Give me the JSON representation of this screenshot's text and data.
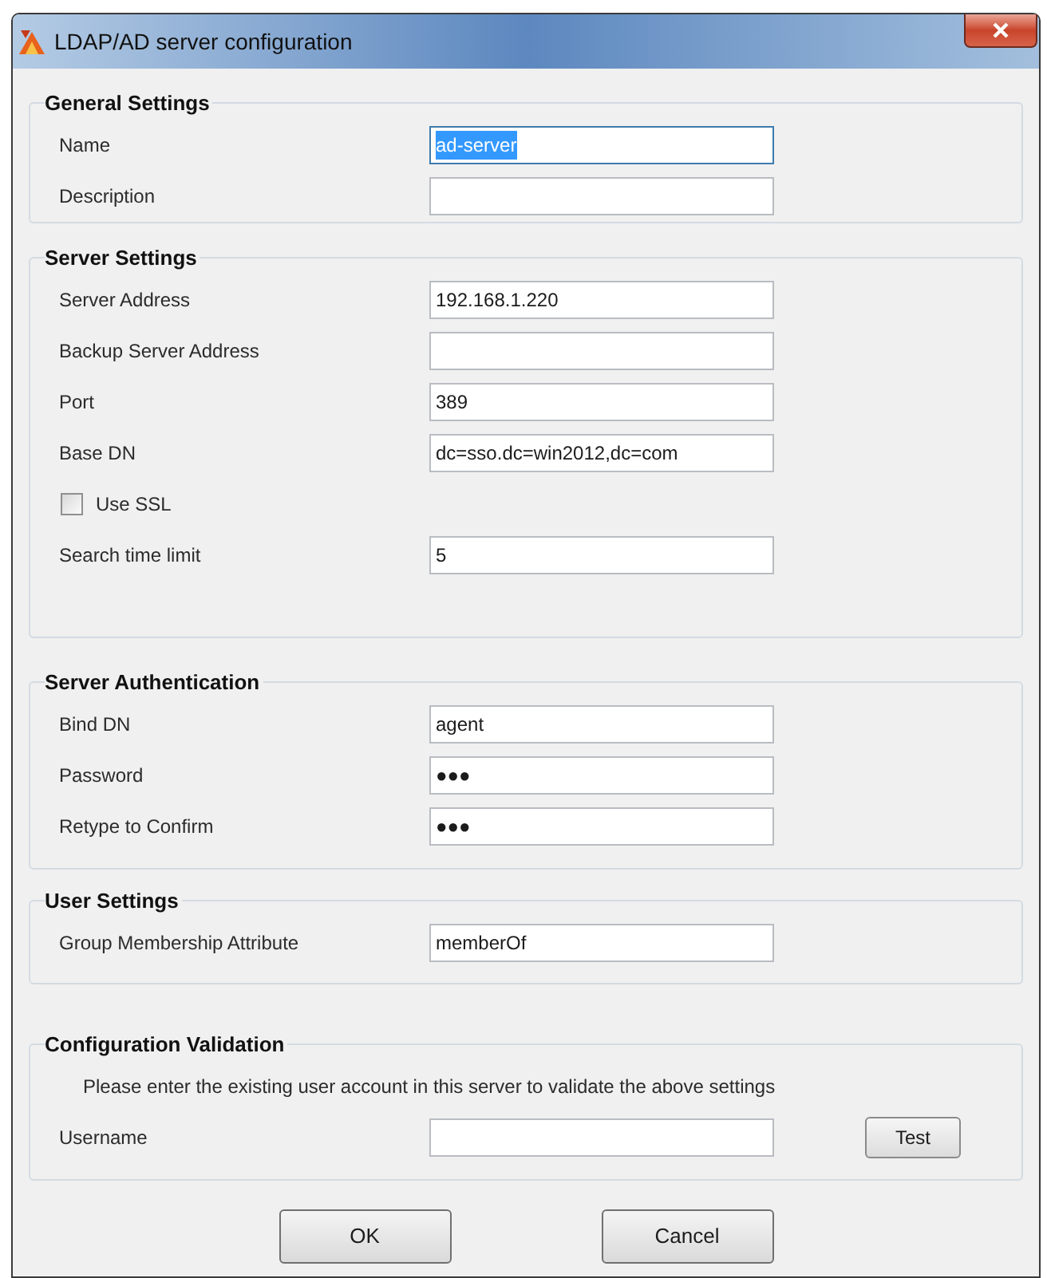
{
  "window": {
    "title": "LDAP/AD server configuration"
  },
  "groups": [
    {
      "title": "General Settings",
      "rows": [
        {
          "kind": "field",
          "label": "Name",
          "value": "ad-server",
          "highlighted": true
        },
        {
          "kind": "field",
          "label": "Description",
          "highlighted": false
        }
      ]
    },
    {
      "title": "Server Settings",
      "rows": [
        {
          "kind": "field",
          "label": "Server Address",
          "value": "192.168.1.220",
          "highlighted": false
        },
        {
          "kind": "field",
          "label": "Backup Server Address",
          "highlighted": false
        },
        {
          "kind": "field",
          "label": "Port",
          "value": "389",
          "highlighted": false
        },
        {
          "kind": "field",
          "label": "Base DN",
          "value": "dc=sso.dc=win2012,dc=com",
          "highlighted": false
        },
        {
          "kind": "checkbox",
          "label": "Use SSL",
          "checked": false
        },
        {
          "kind": "field",
          "label": "Search time limit",
          "value": "5",
          "highlighted": false
        }
      ]
    },
    {
      "title": "Server Authentication",
      "rows": [
        {
          "kind": "field",
          "label": "Bind DN",
          "value": "agent",
          "highlighted": false
        },
        {
          "kind": "field",
          "label": "Password",
          "value": "●●●",
          "highlighted": false
        },
        {
          "kind": "field",
          "label": "Retype to Confirm",
          "value": "●●●",
          "highlighted": false
        }
      ]
    },
    {
      "title": "User Settings",
      "rows": [
        {
          "kind": "field",
          "label": "Group Membership Attribute",
          "value": "memberOf",
          "highlighted": false
        }
      ]
    },
    {
      "title": "Configuration Validation",
      "rows": [
        {
          "kind": "note",
          "text": "Please enter the existing user account in this server to validate the above settings"
        },
        {
          "kind": "field",
          "label": "Username",
          "highlighted": false,
          "button": "Test"
        }
      ]
    }
  ],
  "buttons": [
    "OK",
    "Cancel"
  ]
}
